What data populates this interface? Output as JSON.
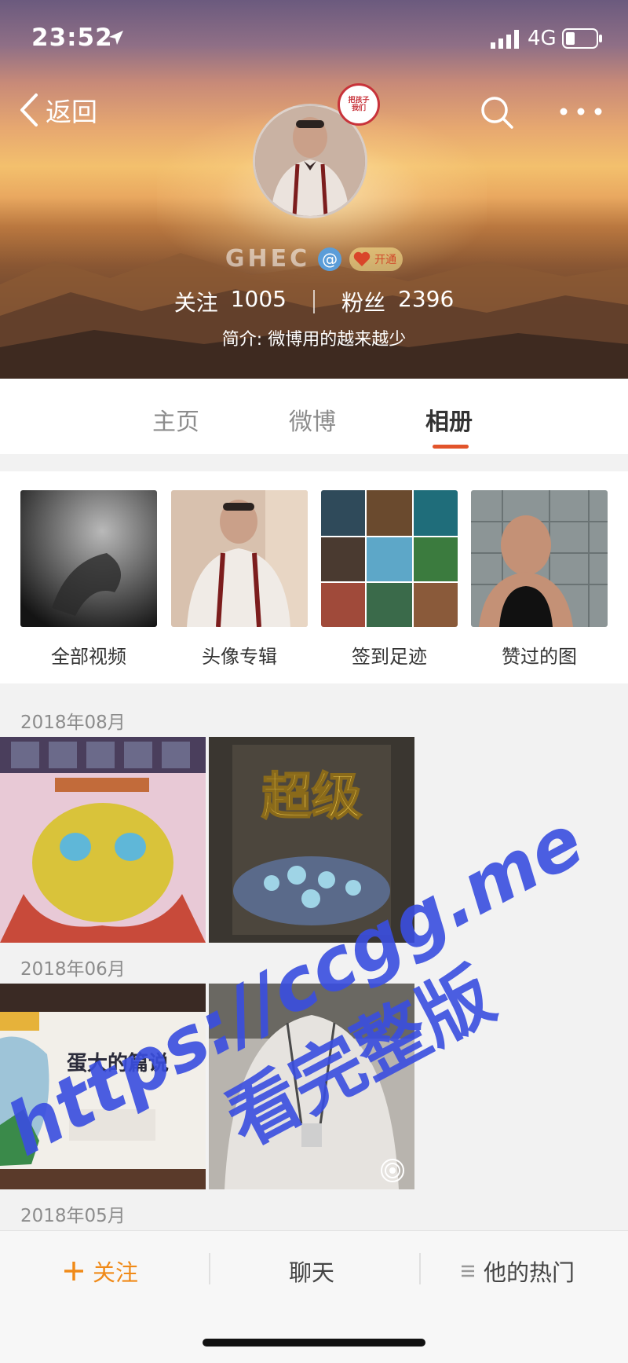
{
  "status_bar": {
    "time": "23:52",
    "network": "4G"
  },
  "nav": {
    "back_label": "返回"
  },
  "profile": {
    "username": "GHEC",
    "badge_text_line1": "把孩子",
    "badge_text_line2": "我们",
    "vip_label": "开通",
    "following_label": "关注",
    "following_count": "1005",
    "followers_label": "粉丝",
    "followers_count": "2396",
    "bio": "简介: 微博用的越来越少"
  },
  "tabs": [
    {
      "label": "主页"
    },
    {
      "label": "微博"
    },
    {
      "label": "相册",
      "active": true
    }
  ],
  "categories": [
    {
      "label": "全部视频"
    },
    {
      "label": "头像专辑"
    },
    {
      "label": "签到足迹"
    },
    {
      "label": "赞过的图"
    }
  ],
  "sections": [
    {
      "date": "2018年08月",
      "photos": [
        "game-dragon-photo",
        "super-text-photo"
      ],
      "photo_text": "超级"
    },
    {
      "date": "2018年06月",
      "photos": [
        "game-promo-photo",
        "person-photo"
      ],
      "photo_text": "蛋大的篇说"
    },
    {
      "date": "2018年05月",
      "photos": []
    }
  ],
  "watermark": {
    "line1": "https://ccgg.me",
    "line2": "看完整版"
  },
  "bottom_bar": {
    "follow_label": "关注",
    "chat_label": "聊天",
    "hot_label": "他的热门"
  },
  "colors": {
    "accent": "#e2542b",
    "follow": "#f08a18",
    "watermark": "#3a4ee0"
  }
}
